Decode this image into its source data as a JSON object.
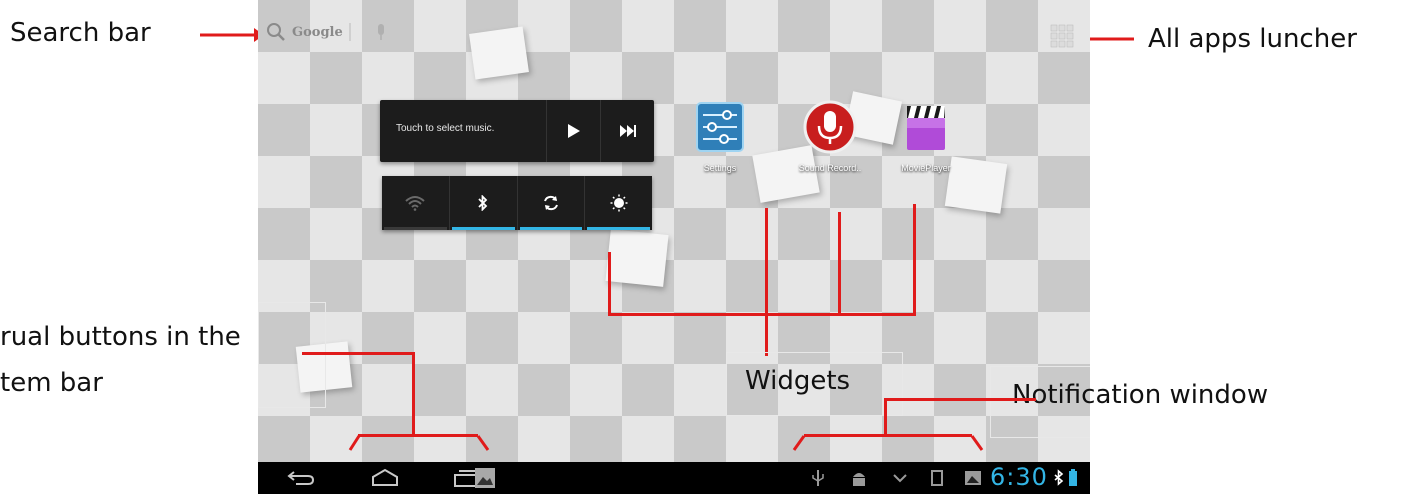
{
  "annotations": {
    "search_bar": "Search bar",
    "all_apps": "All apps luncher",
    "virtual_buttons_line1": "rual  buttons  in  the",
    "virtual_buttons_line2": "tem bar",
    "widgets": "Widgets",
    "notification_window": "Notification window"
  },
  "screen": {
    "search": {
      "label": "Google"
    },
    "music_widget": {
      "text": "Touch to select music."
    },
    "power_widget": {
      "items": [
        "wifi-icon",
        "bluetooth-icon",
        "sync-icon",
        "brightness-icon"
      ],
      "active": [
        false,
        true,
        true,
        true
      ]
    },
    "apps": [
      {
        "label": "Settings",
        "icon": "settings-icon"
      },
      {
        "label": "Sound Record..",
        "icon": "microphone-icon"
      },
      {
        "label": "MoviePlayer",
        "icon": "clapperboard-icon"
      }
    ],
    "system_bar": {
      "clock": "6:30",
      "accent_color": "#33b5e5"
    }
  },
  "colors": {
    "callout": "#e01b1b",
    "holo_blue": "#33b5e5"
  }
}
